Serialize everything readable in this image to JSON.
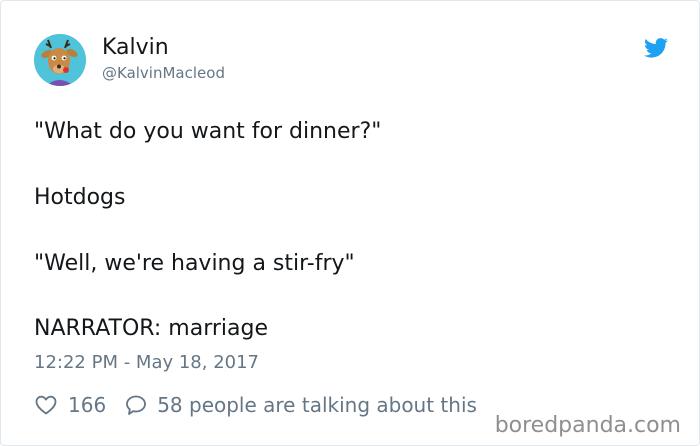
{
  "author": {
    "display_name": "Kalvin",
    "handle": "@KalvinMacleod",
    "avatar_icon": "deer-avatar-icon"
  },
  "platform_icon": "twitter-bird-icon",
  "tweet": {
    "lines": [
      "\"What do you want for dinner?\"",
      "Hotdogs",
      "\"Well, we're having a stir-fry\"",
      "NARRATOR: marriage"
    ]
  },
  "timestamp": "12:22 PM - May 18, 2017",
  "actions": {
    "like_icon": "heart-icon",
    "like_count": "166",
    "reply_icon": "speech-bubble-icon",
    "reply_text": "58 people are talking about this"
  },
  "watermark": "boredpanda.com",
  "colors": {
    "text": "#14171a",
    "secondary": "#657786",
    "twitter_blue": "#1da1f2",
    "border": "#e1e8ed",
    "avatar_bg": "#4fc3d9"
  }
}
